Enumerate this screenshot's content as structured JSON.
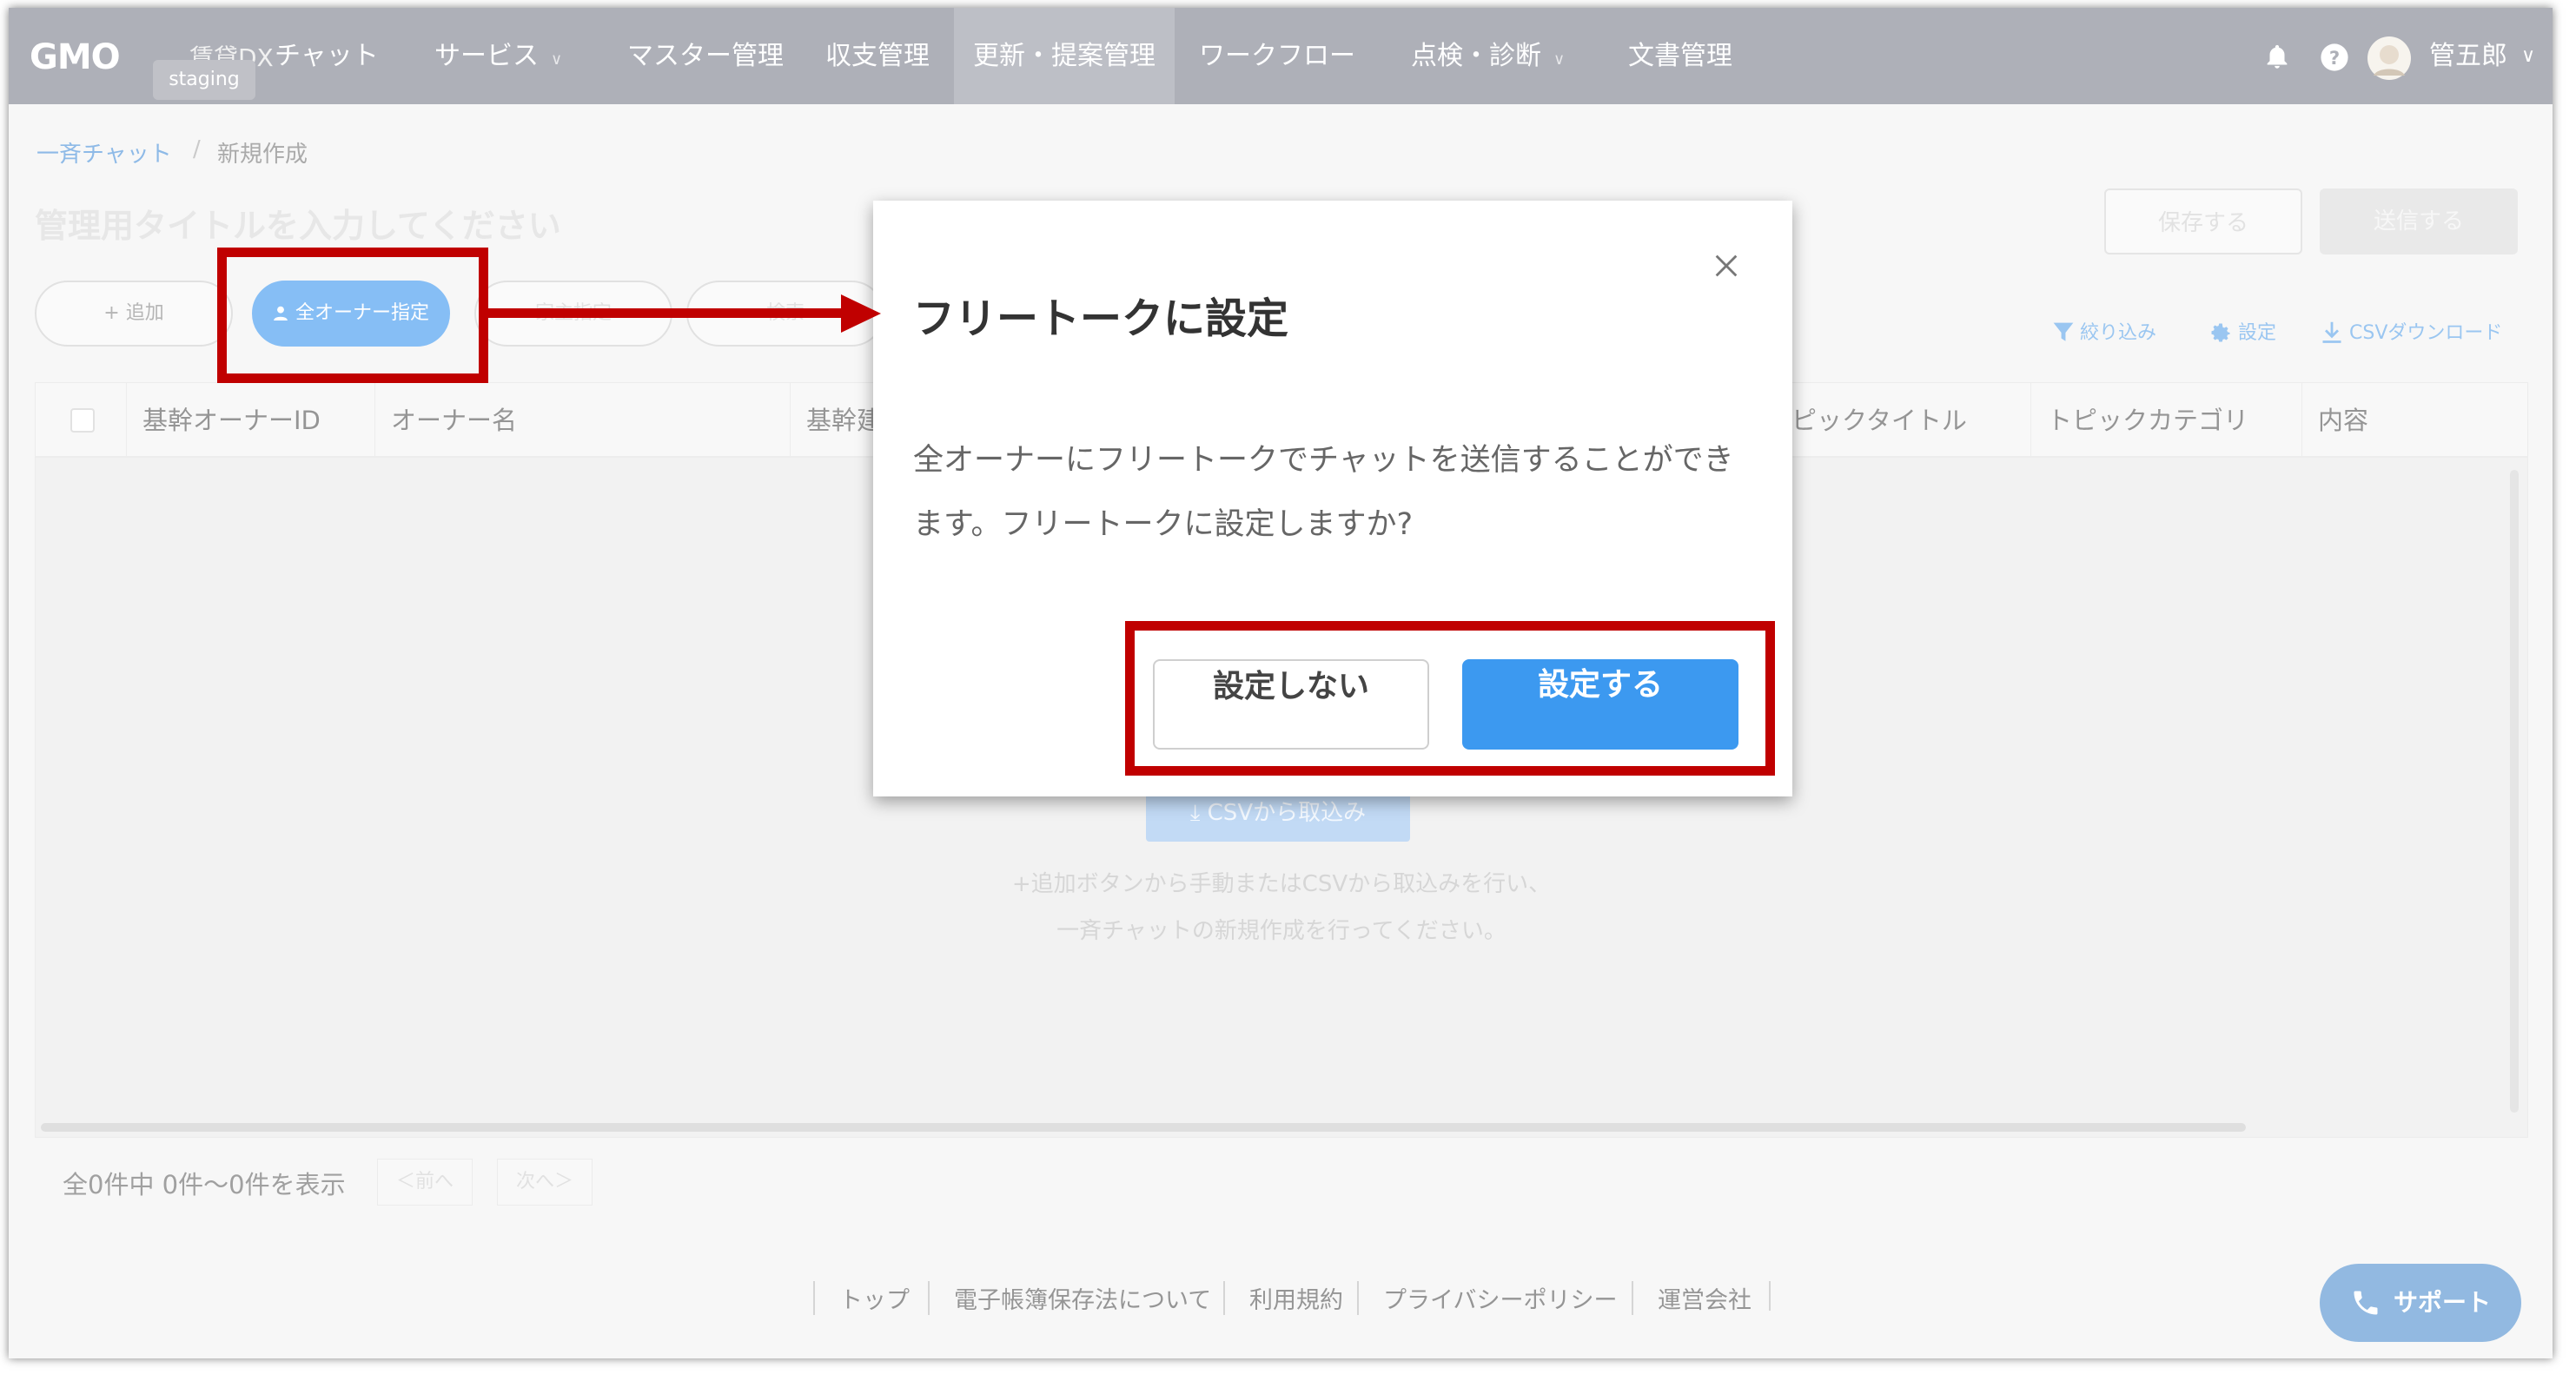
{
  "header": {
    "logo": "GMO",
    "logo_sub": "賃貸DX",
    "env_badge": "staging",
    "nav": [
      {
        "label": "チャット",
        "dropdown": false
      },
      {
        "label": "サービス",
        "dropdown": true
      },
      {
        "label": "マスター管理",
        "dropdown": false
      },
      {
        "label": "収支管理",
        "dropdown": false
      },
      {
        "label": "更新・提案管理",
        "dropdown": false,
        "active": true
      },
      {
        "label": "ワークフロー",
        "dropdown": false
      },
      {
        "label": "点検・診断",
        "dropdown": true
      },
      {
        "label": "文書管理",
        "dropdown": false
      }
    ],
    "user_name": "管五郎",
    "icons": [
      "bell-icon",
      "help-icon",
      "avatar",
      "chevron-down-icon"
    ]
  },
  "breadcrumb": {
    "parent": "一斉チャット",
    "separator": "/",
    "current": "新規作成"
  },
  "title_placeholder": "管理用タイトルを入力してください",
  "actions": {
    "save": "保存する",
    "send": "送信する"
  },
  "pills": {
    "add": "+ 追加",
    "all_owners": "全オーナー指定",
    "p3": "家主指定",
    "p4": "検索"
  },
  "tools": {
    "filter": "絞り込み",
    "settings": "設定",
    "csv_download": "CSVダウンロード"
  },
  "table": {
    "columns": [
      "基幹オーナーID",
      "オーナー名",
      "基幹建",
      "ピックタイトル",
      "トピックカテゴリ",
      "内容"
    ]
  },
  "empty": {
    "csv_button": "CSVから取込み",
    "line1": "+追加ボタンから手動またはCSVから取込みを行い、",
    "line2": "一斉チャットの新規作成を行ってください。"
  },
  "pagination": {
    "info": "全0件中 0件～0件を表示",
    "prev": "＜前へ",
    "next": "次へ＞"
  },
  "footer": {
    "links": [
      "トップ",
      "電子帳簿保存法について",
      "利用規約",
      "プライバシーポリシー",
      "運営会社"
    ]
  },
  "support": "サポート",
  "modal": {
    "title": "フリートークに設定",
    "body": "全オーナーにフリートークでチャットを送信することができます。フリートークに設定しますか?",
    "cancel": "設定しない",
    "confirm": "設定する"
  },
  "colors": {
    "header_bg": "#7c808d",
    "primary": "#3c99f0",
    "annotation": "#c00000",
    "link": "#4a90d9"
  }
}
